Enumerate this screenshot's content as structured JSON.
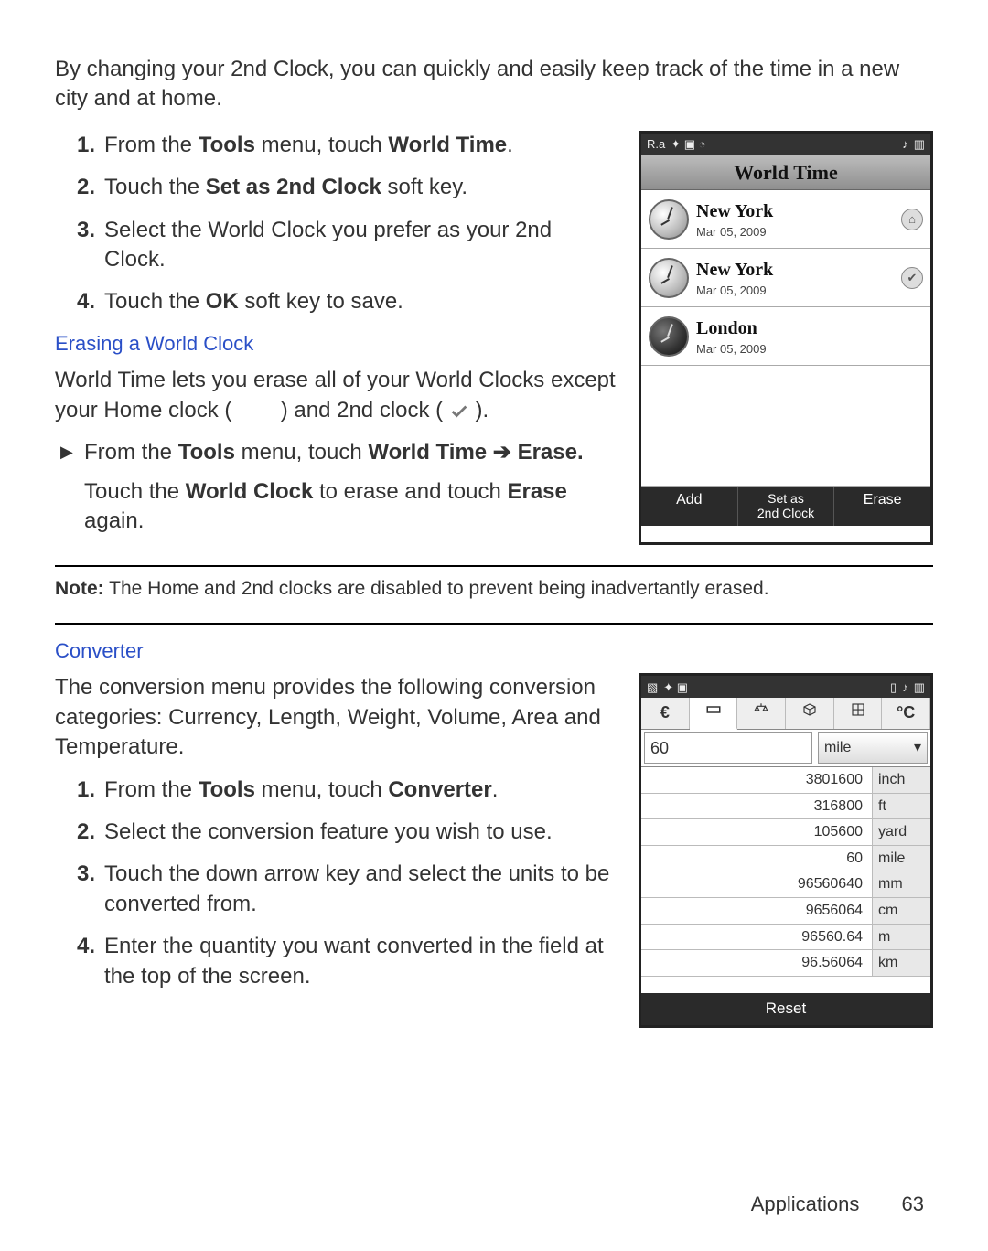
{
  "intro": "By changing your 2nd Clock, you can quickly and easily keep track of the time in a new city and at home.",
  "steps1": {
    "s1a": "From the ",
    "s1b": "Tools",
    "s1c": " menu, touch ",
    "s1d": "World Time",
    "s1e": ".",
    "s2a": "Touch the ",
    "s2b": "Set as 2nd Clock",
    "s2c": " soft key.",
    "s3": "Select the World Clock you prefer as your 2nd Clock.",
    "s4a": "Touch the ",
    "s4b": "OK",
    "s4c": " soft key to save."
  },
  "erase_head": "Erasing a World Clock",
  "erase_p1a": "World Time lets you erase all of your World Clocks except your Home clock (",
  "erase_p1b": ") and 2nd clock (",
  "erase_p1c": ").",
  "erase_bullet_a": "From the ",
  "erase_bullet_b": "Tools",
  "erase_bullet_c": " menu, touch ",
  "erase_bullet_d": "World Time ➔ Erase.",
  "erase_sub_a": "Touch the ",
  "erase_sub_b": "World Clock",
  "erase_sub_c": " to erase and touch ",
  "erase_sub_d": "Erase",
  "erase_sub_e": " again.",
  "note_label": "Note:",
  "note_text": " The Home and 2nd clocks are disabled to prevent being inadvertantly erased.",
  "converter_head": "Converter",
  "converter_p": "The conversion menu provides the following conversion categories: Currency, Length, Weight, Volume, Area and Temperature.",
  "steps2": {
    "s1a": "From the ",
    "s1b": "Tools",
    "s1c": " menu, touch ",
    "s1d": "Converter",
    "s1e": ".",
    "s2": "Select the conversion feature you wish to use.",
    "s3": "Touch the down arrow key and select the units to be converted from.",
    "s4": "Enter the quantity you want converted in the field at the top of the screen."
  },
  "worldtime_phone": {
    "status_left": "R.a",
    "title": "World Time",
    "rows": [
      {
        "city": "New York",
        "date": "Mar 05, 2009",
        "icon": "home"
      },
      {
        "city": "New York",
        "date": "Mar 05, 2009",
        "icon": "check"
      },
      {
        "city": "London",
        "date": "Mar 05, 2009",
        "icon": ""
      }
    ],
    "soft_left": "Add",
    "soft_mid_top": "Set as",
    "soft_mid_bot": "2nd Clock",
    "soft_right": "Erase"
  },
  "converter_phone": {
    "tabs": [
      "€",
      "⬚",
      "⬚",
      "⬚",
      "⊞",
      "°C"
    ],
    "tab_icons": [
      "euro",
      "image",
      "scale",
      "cube",
      "grid",
      "temp"
    ],
    "input_value": "60",
    "input_unit": "mile",
    "results": [
      {
        "v": "3801600",
        "u": "inch"
      },
      {
        "v": "316800",
        "u": "ft"
      },
      {
        "v": "105600",
        "u": "yard"
      },
      {
        "v": "60",
        "u": "mile"
      },
      {
        "v": "96560640",
        "u": "mm"
      },
      {
        "v": "9656064",
        "u": "cm"
      },
      {
        "v": "96560.64",
        "u": "m"
      },
      {
        "v": "96.56064",
        "u": "km"
      }
    ],
    "soft": "Reset"
  },
  "footer_section": "Applications",
  "footer_page": "63",
  "nums": {
    "n1": "1.",
    "n2": "2.",
    "n3": "3.",
    "n4": "4."
  }
}
